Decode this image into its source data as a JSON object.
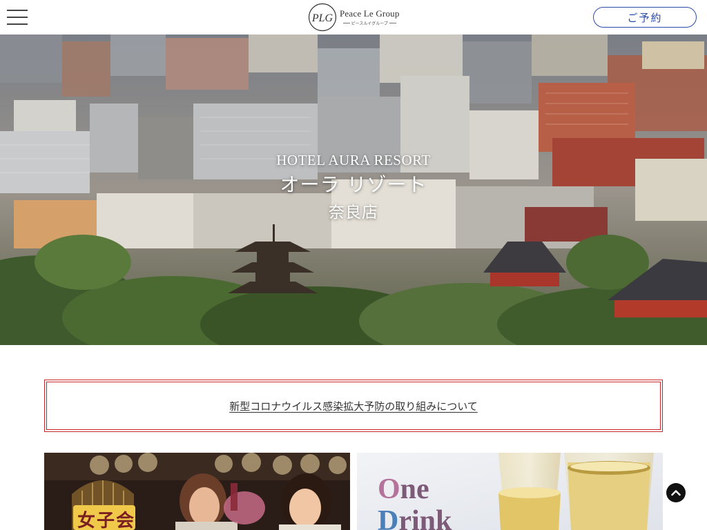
{
  "header": {
    "brand_name": "Peace Le Group",
    "brand_sub": "ピースルイグループ",
    "logo_monogram": "PLG",
    "reserve_label": "ご予約"
  },
  "hero": {
    "title_en": "HOTEL AURA RESORT",
    "title_ja": "オーラ リゾート",
    "branch": "奈良店"
  },
  "notice": {
    "link_text": "新型コロナウイルス感染拡大予防の取り組みについて",
    "border_color": "#c9262b"
  },
  "banners": {
    "left": {
      "badge": "女子会"
    },
    "right": {
      "line1_first": "O",
      "line1_rest": "ne",
      "line2_first": "D",
      "line2_rest": "rink"
    }
  },
  "colors": {
    "accent": "#2a4aa8",
    "notice": "#c9262b"
  },
  "icons": {
    "menu": "hamburger-icon",
    "top": "chevron-up-icon"
  }
}
